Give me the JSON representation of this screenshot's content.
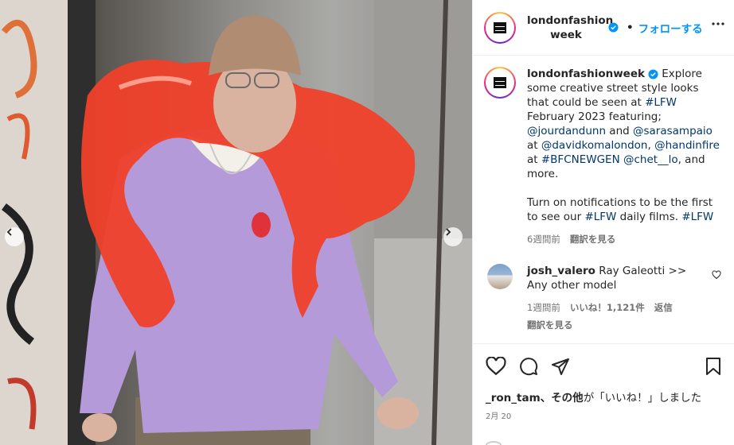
{
  "post": {
    "username": "londonfashion​week",
    "username_line1": "londonfashion",
    "username_line2": "week",
    "follow_label": "フォローする",
    "separator": "•"
  },
  "caption": {
    "username": "londonfashionweek",
    "parts": [
      {
        "t": " Explore some creative street style looks that could be seen at ",
        "link": false
      },
      {
        "t": "#LFW",
        "link": true
      },
      {
        "t": " February 2023 featuring; ",
        "link": false
      },
      {
        "t": "@jourdandunn",
        "link": true
      },
      {
        "t": " and ",
        "link": false
      },
      {
        "t": "@sarasampaio",
        "link": true
      },
      {
        "t": " at ",
        "link": false
      },
      {
        "t": "@davidkomalondon",
        "link": true
      },
      {
        "t": ", ",
        "link": false
      },
      {
        "t": "@handinfire",
        "link": true
      },
      {
        "t": " at ",
        "link": false
      },
      {
        "t": "#BFCNEWGEN",
        "link": true
      },
      {
        "t": " ",
        "link": false
      },
      {
        "t": "@chet__lo",
        "link": true
      },
      {
        "t": ", and more.",
        "link": false
      }
    ],
    "para2_parts": [
      {
        "t": "Turn on notifications to be the first to see our ",
        "link": false
      },
      {
        "t": "#LFW",
        "link": true
      },
      {
        "t": " daily films. ",
        "link": false
      },
      {
        "t": "#LFW",
        "link": true
      }
    ],
    "time": "6週間前",
    "translate": "翻訳を見る"
  },
  "comment": {
    "username": "josh_valero",
    "text": "Ray Galeotti >> Any other model",
    "time": "1週間前",
    "likes": "いいね！1,121件",
    "reply": "返信",
    "translate": "翻訳を見る"
  },
  "likes_line": {
    "user": "_ron_tam",
    "sep": "、",
    "others": "その他",
    "suffix": "が「いいね！」しました"
  },
  "date": "2月 20",
  "icons": [
    "verified-badge-icon",
    "more-icon",
    "heart-icon",
    "comment-icon",
    "share-icon",
    "bookmark-icon",
    "chevron-left-icon",
    "chevron-right-icon"
  ],
  "colors": {
    "accent": "#0095f6",
    "link": "#00376b",
    "meta": "#737373",
    "balloon": "#f0402a",
    "sweater": "#b49ad8"
  }
}
